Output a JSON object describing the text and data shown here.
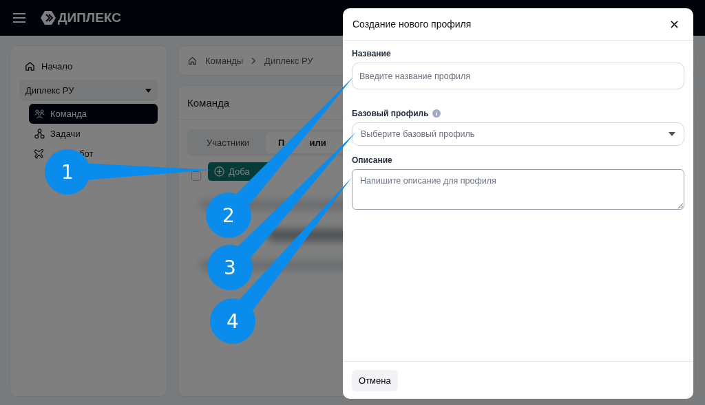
{
  "topbar": {
    "logo": "ДИПЛЕКС"
  },
  "sidebar": {
    "home": "Начало",
    "team_select": "Диплекс РУ",
    "items": [
      {
        "label": "Команда",
        "selected": true
      },
      {
        "label": "Задачи",
        "selected": false
      },
      {
        "label_end": "бот",
        "selected": false
      }
    ]
  },
  "breadcrumbs": [
    "Команды",
    "Диплекс РУ"
  ],
  "panel": {
    "title": "Команда",
    "tabs": [
      {
        "label": "Участники",
        "selected": false
      },
      {
        "label_start": "П",
        "label_end": "или",
        "selected": true
      }
    ],
    "checkbox_checked": false,
    "add_button": "Доба"
  },
  "modal": {
    "title": "Создание нового профиля",
    "fields": [
      {
        "kind": "input",
        "label": "Название",
        "placeholder": "Введите название профиля",
        "info": false
      },
      {
        "kind": "select",
        "label": "Базовый профиль",
        "placeholder": "Выберите базовый профиль",
        "info": true
      },
      {
        "kind": "textarea",
        "label": "Описание",
        "placeholder": "Напишите описание для профиля",
        "info": false
      }
    ],
    "cancel_button": "Отмена"
  },
  "callouts": [
    {
      "number": "1"
    },
    {
      "number": "2"
    },
    {
      "number": "3"
    },
    {
      "number": "4"
    }
  ]
}
